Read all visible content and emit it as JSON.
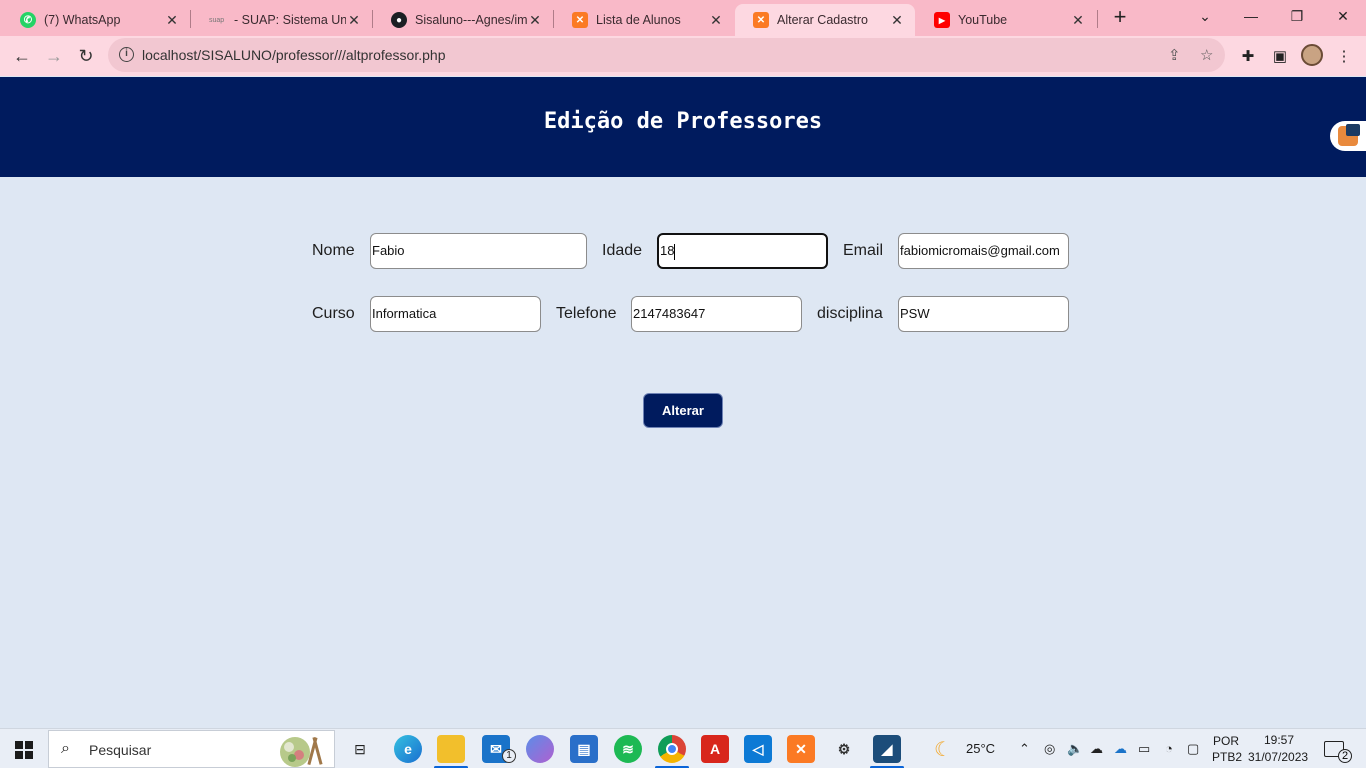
{
  "browser": {
    "tabs": [
      {
        "title": "(7) WhatsApp",
        "icon": "whatsapp-icon",
        "color": "#25d366"
      },
      {
        "title": "- SUAP: Sistema Unific",
        "icon": "suap-icon",
        "color": "#f9b9c8",
        "prefix": "suap"
      },
      {
        "title": "Sisaluno---Agnes/ima",
        "icon": "github-icon",
        "color": "#1b1f23"
      },
      {
        "title": "Lista de Alunos",
        "icon": "xampp-icon",
        "color": "#fb7a24"
      },
      {
        "title": "Alterar Cadastro",
        "icon": "xampp-icon",
        "color": "#fb7a24"
      },
      {
        "title": "YouTube",
        "icon": "youtube-icon",
        "color": "#ff0000"
      }
    ],
    "active_tab_index": 4,
    "url": "localhost/SISALUNO/professor///altprofessor.php"
  },
  "page": {
    "title": "Edição de Professores",
    "form": {
      "nome_label": "Nome",
      "nome_value": "Fabio",
      "idade_label": "Idade",
      "idade_value": "18",
      "email_label": "Email",
      "email_value": "fabiomicromais@gmail.com",
      "curso_label": "Curso",
      "curso_value": "Informatica",
      "telefone_label": "Telefone",
      "telefone_value": "2147483647",
      "disciplina_label": "disciplina",
      "disciplina_value": "PSW",
      "submit_label": "Alterar"
    },
    "colors": {
      "header": "#001b5e",
      "background": "#dee7f3",
      "button": "#001b5e"
    }
  },
  "taskbar": {
    "search_placeholder": "Pesquisar",
    "weather": "25°C",
    "language": "POR",
    "layout": "PTB2",
    "time": "19:57",
    "date": "31/07/2023",
    "mail_badge": "1",
    "notification_count": "2"
  }
}
